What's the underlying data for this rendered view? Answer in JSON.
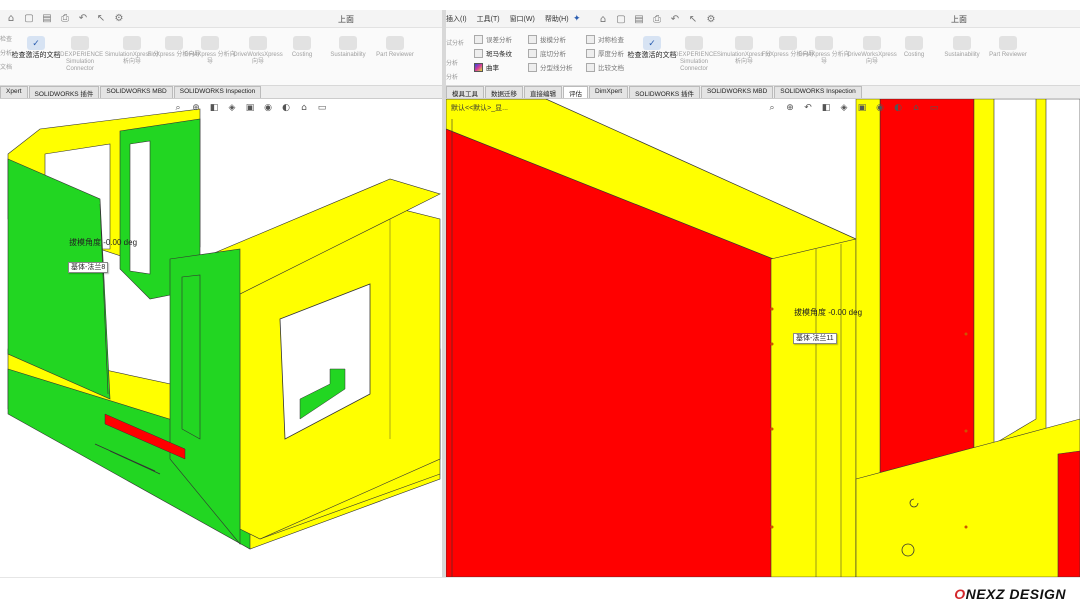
{
  "colors": {
    "green": "#22d622",
    "yellow": "#ffff00",
    "red": "#ff0000",
    "accent": "#2a5db0"
  },
  "left": {
    "quick_access_icons": [
      "home-icon",
      "new-icon",
      "open-icon",
      "print-icon",
      "undo-icon",
      "select-icon",
      "options-icon"
    ],
    "title": "上面",
    "ribbon": {
      "side_labels": [
        "检查",
        "分析",
        "文档"
      ],
      "active_button": {
        "label": "检查激活的文档",
        "icon": "check-document-icon"
      },
      "buttons": [
        "3DEXPERIENCE Simulation Connector",
        "SimulationXpress 分析向导",
        "FloXpress 分析向导",
        "DFMXpress 分析向导",
        "DriveWorksXpress 向导",
        "Costing",
        "Sustainability",
        "Part Reviewer"
      ]
    },
    "tabs": [
      "Xpert",
      "SOLIDWORKS 插件",
      "SOLIDWORKS MBD",
      "SOLIDWORKS Inspection"
    ],
    "annotation_text": "拔模角度 -0.00 deg",
    "tag_text": "基体-法兰8"
  },
  "right": {
    "menus": [
      "插入(I)",
      "工具(T)",
      "窗口(W)",
      "帮助(H)"
    ],
    "title": "上面",
    "ribbon": {
      "analysis_items": [
        "误差分析",
        "斑马条纹",
        "曲率",
        "拔模分析",
        "底切分析",
        "分型线分析",
        "对称检查",
        "厚度分析",
        "比较文档"
      ],
      "side_labels": [
        "试分析",
        "分析",
        "分析"
      ],
      "active_button": {
        "label": "检查激活的文档",
        "icon": "check-document-icon"
      },
      "buttons": [
        "3DEXPERIENCE Simulation Connector",
        "SimulationXpress 分析向导",
        "FloXpress 分析向导",
        "DFMXpress 分析向导",
        "DriveWorksXpress 向导",
        "Costing",
        "Sustainability",
        "Part Reviewer"
      ]
    },
    "tabs": [
      "模具工具",
      "数据迁移",
      "直接编辑",
      "评估",
      "DimXpert",
      "SOLIDWORKS 插件",
      "SOLIDWORKS MBD",
      "SOLIDWORKS Inspection"
    ],
    "active_tab": "评估",
    "breadcrumb": "默认<<默认>_显...",
    "annotation_text": "拔模角度 -0.00 deg",
    "tag_text": "基体-法兰11"
  },
  "brand": {
    "prefix": "O",
    "rest": "NEXZ DESIGN"
  }
}
